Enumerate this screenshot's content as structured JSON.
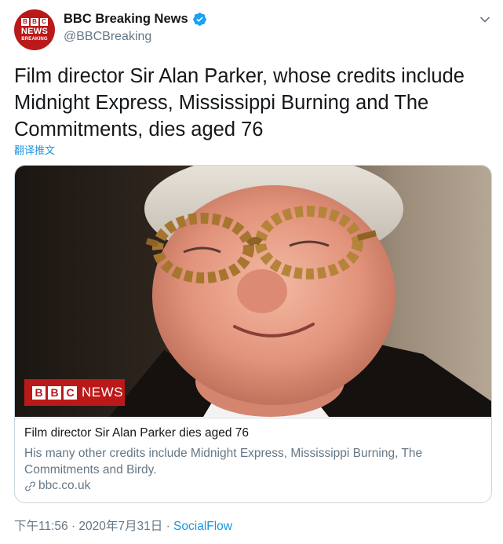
{
  "account": {
    "display_name": "BBC Breaking News",
    "handle": "@BBCBreaking",
    "avatar": {
      "blocks": [
        "B",
        "B",
        "C"
      ],
      "line1": "NEWS",
      "line2": "BREAKING"
    },
    "verified_icon": "verified-badge-icon"
  },
  "menu_icon": "chevron-down-icon",
  "tweet": {
    "text": "Film director Sir Alan Parker, whose credits include Midnight Express, Mississippi Burning and The Commitments, dies aged 76",
    "translate_label": "翻译推文"
  },
  "card": {
    "logo_blocks": [
      "B",
      "B",
      "C"
    ],
    "logo_word": "NEWS",
    "title": "Film director Sir Alan Parker dies aged 76",
    "description": "His many other credits include Midnight Express, Mississippi Burning, The Commitments and Birdy.",
    "domain": "bbc.co.uk",
    "domain_icon": "link-icon"
  },
  "meta": {
    "time": "下午11:56 · 2020年7月31日",
    "separator": " · ",
    "source": "SocialFlow"
  },
  "colors": {
    "brand_red": "#bb1919",
    "link_blue": "#1b95e0",
    "muted": "#657786",
    "text": "#14171a"
  }
}
